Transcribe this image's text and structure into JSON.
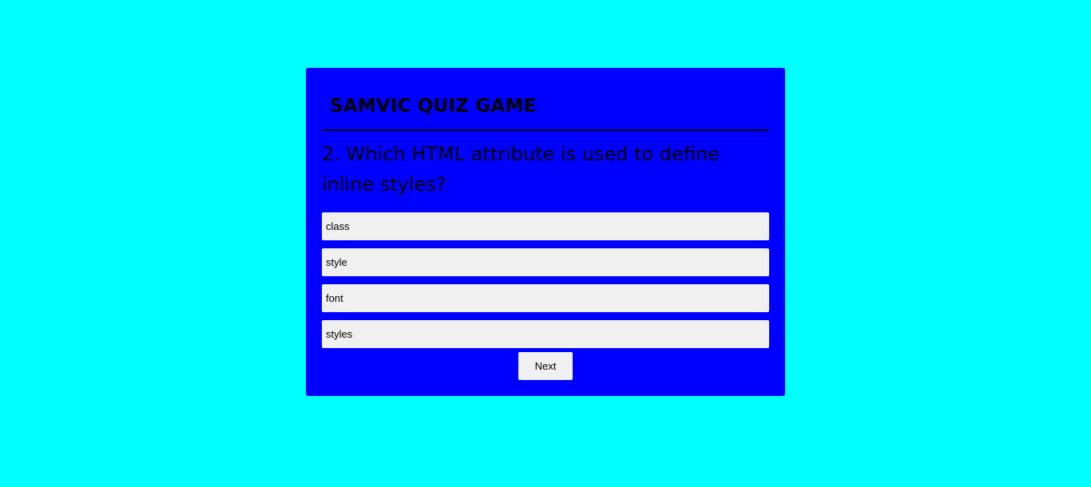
{
  "colors": {
    "page_background": "#00ffff",
    "card_background": "#0000ff",
    "button_background": "#f0f0f0"
  },
  "quiz": {
    "title": "SAMVIC QUIZ GAME",
    "question": "2. Which HTML attribute is used to define inline styles?",
    "answers": [
      {
        "label": "class"
      },
      {
        "label": "style"
      },
      {
        "label": "font"
      },
      {
        "label": "styles"
      }
    ],
    "next_label": "Next"
  }
}
